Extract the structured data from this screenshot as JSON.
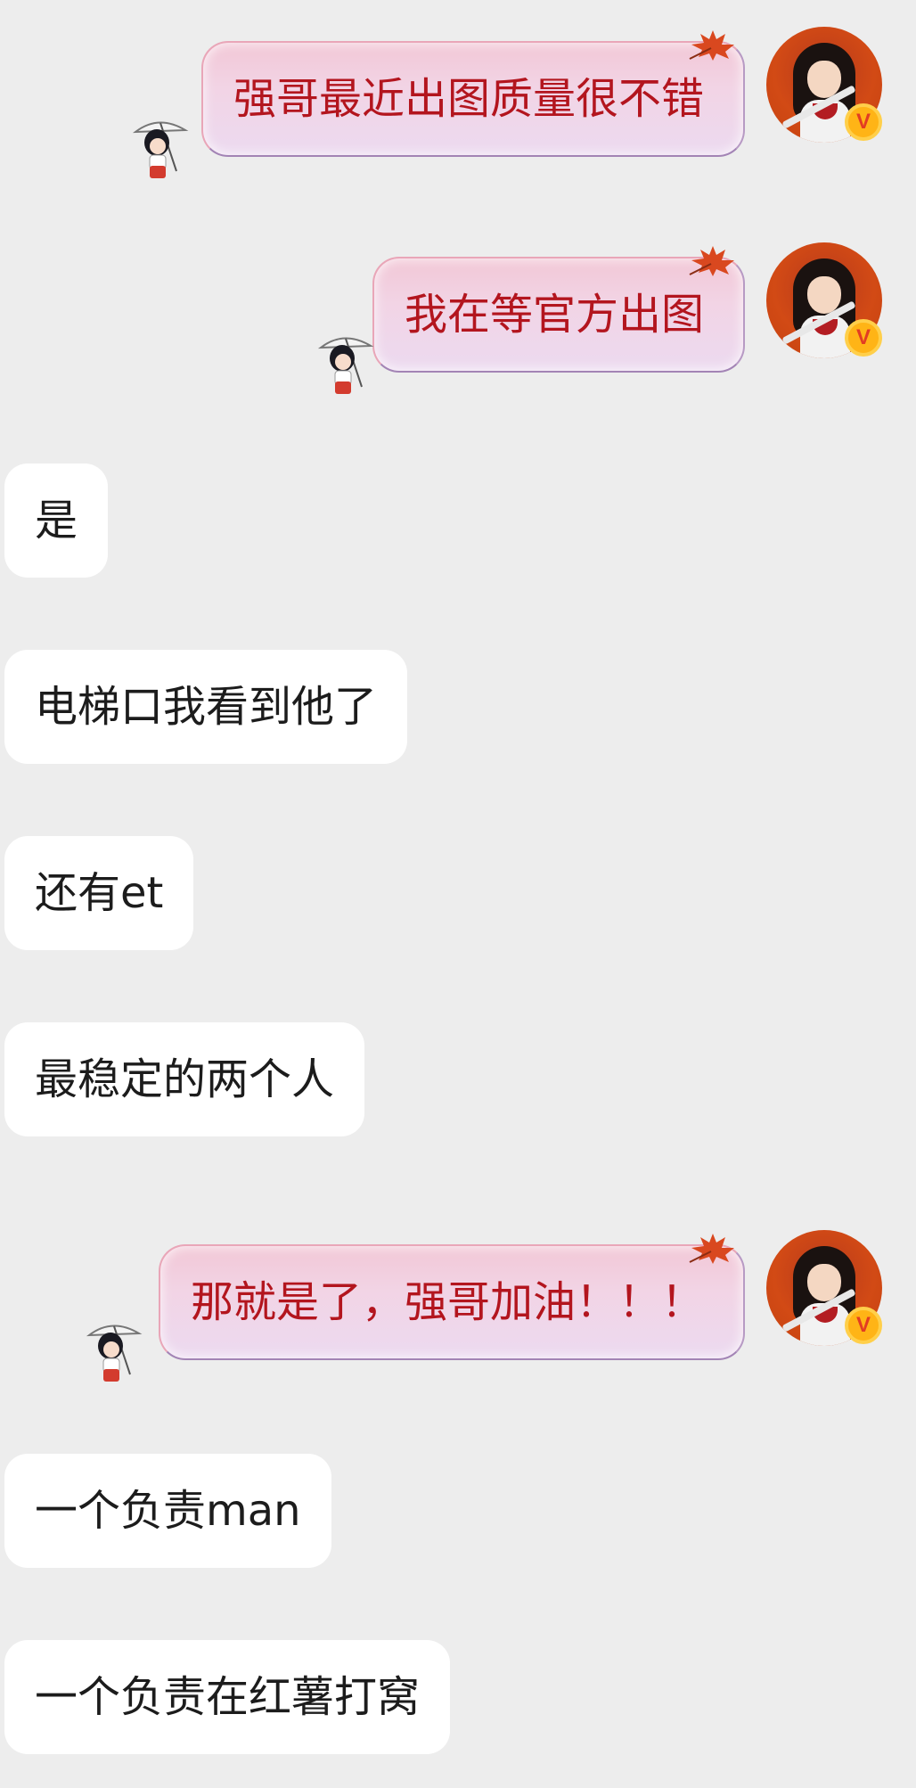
{
  "messages_out": [
    {
      "text": "强哥最近出图质量很不错"
    },
    {
      "text": "我在等官方出图"
    },
    {
      "text": "那就是了，强哥加油！！！"
    }
  ],
  "messages_in": [
    {
      "text": "是"
    },
    {
      "text": "电梯口我看到他了"
    },
    {
      "text": "还有et"
    },
    {
      "text": "最稳定的两个人"
    },
    {
      "text": "一个负责man"
    },
    {
      "text": "一个负责在红薯打窝"
    }
  ],
  "badge": {
    "label": "V"
  },
  "colors": {
    "background": "#ededed",
    "out_text": "#b3151e",
    "in_bubble": "#ffffff",
    "vip": "#ffb416"
  }
}
